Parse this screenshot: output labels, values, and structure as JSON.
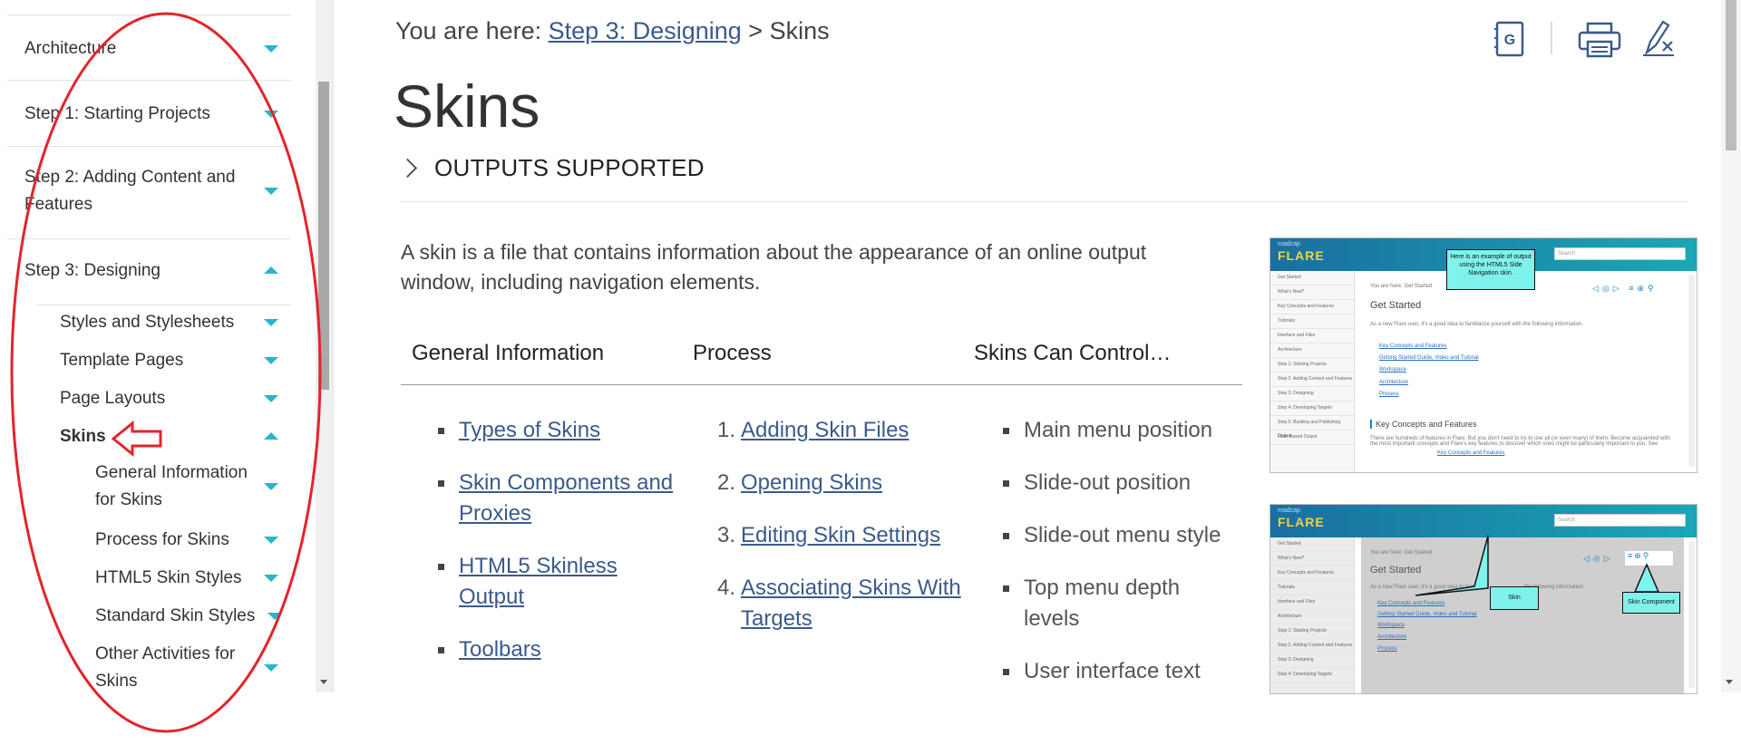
{
  "sidebar": {
    "items": [
      {
        "label": "Architecture",
        "expanded": false
      },
      {
        "label": "Step 1: Starting Projects",
        "expanded": false
      },
      {
        "label": "Step 2: Adding Content and Features",
        "expanded": false
      },
      {
        "label": "Step 3: Designing",
        "expanded": true
      },
      {
        "label": "Styles and Stylesheets",
        "expanded": false
      },
      {
        "label": "Template Pages",
        "expanded": false
      },
      {
        "label": "Page Layouts",
        "expanded": false
      },
      {
        "label": "Skins",
        "expanded": true,
        "selected": true
      },
      {
        "label": "General Information for Skins",
        "expanded": false
      },
      {
        "label": "Process for Skins",
        "expanded": false
      },
      {
        "label": "HTML5 Skin Styles",
        "expanded": false
      },
      {
        "label": "Standard Skin Styles",
        "expanded": false
      },
      {
        "label": "Other Activities for Skins",
        "expanded": false
      }
    ]
  },
  "breadcrumb": {
    "prefix": "You are here: ",
    "link": "Step 3: Designing",
    "separator": " > ",
    "current": "Skins"
  },
  "page": {
    "title": "Skins",
    "outputs_label": "OUTPUTS SUPPORTED",
    "intro": "A skin is a file that contains information about the appearance of an online output window, including navigation elements."
  },
  "toolbar": {
    "glossary_icon": "glossary-icon",
    "print_icon": "print-icon",
    "remove_highlight_icon": "remove-highlight-icon"
  },
  "table": {
    "headers": [
      "General Information",
      "Process",
      "Skins Can Control…"
    ],
    "general": [
      "Types of Skins",
      "Skin Components and Proxies",
      "HTML5 Skinless Output",
      "Toolbars"
    ],
    "process": [
      "Adding Skin Files",
      "Opening Skins",
      "Editing Skin Settings",
      "Associating Skins With Targets"
    ],
    "controls": [
      "Main menu position",
      "Slide-out position",
      "Slide-out menu style",
      "Top menu depth levels",
      "User interface text"
    ]
  },
  "thumb1": {
    "brand_small": "madcap",
    "brand": "FLARE",
    "search": "Search",
    "crumb": "You are here: Get Started",
    "heading": "Get Started",
    "intro": "As a new Flare user, it's a good idea to familiarize yourself with the following information.",
    "links": [
      "Key Concepts and Features",
      "Getting Started Guide, Video and Tutorial",
      "Workspace",
      "Architecture",
      "Process"
    ],
    "section": "Key Concepts and Features",
    "section_text": "There are hundreds of features in Flare. But you don't need to try to use all (or even many) of them. Become acquainted with the most important concepts and Flare's key features to discover which ones might be particularly important to you. See",
    "section_link": "Key Concepts and Features",
    "callout": "Here is an example of output using the HTML5 Side Navigation skin.",
    "side": [
      "Get Started",
      "What's New?",
      "Key Concepts and Features",
      "Tutorials",
      "Interface and Files",
      "Architecture",
      "Step 1: Starting Projects",
      "Step 2: Adding Content and Features",
      "Step 3: Designing",
      "Step 4: Developing Targets",
      "Step 5: Building and Publishing Output",
      "Flare-Based Output"
    ]
  },
  "thumb2": {
    "brand_small": "madcap",
    "brand": "FLARE",
    "search": "Search",
    "crumb": "You are here: Get Started",
    "heading": "Get Started",
    "intro": "As a new Flare user, it's a good idea to fam",
    "intro_tail": "the following information.",
    "links": [
      "Key Concepts and Features",
      "Getting Started Guide, Video and Tutorial",
      "Workspace",
      "Architecture",
      "Process"
    ],
    "callout_skin": "Skin",
    "callout_component": "Skin Component",
    "side": [
      "Get Started",
      "What's New?",
      "Key Concepts and Features",
      "Tutorials",
      "Interface and Files",
      "Architecture",
      "Step 1: Starting Projects",
      "Step 2: Adding Content and Features",
      "Step 3: Designing",
      "Step 4: Developing Targets"
    ]
  },
  "colors": {
    "accent": "#27b7c9",
    "link": "#3b5a8c",
    "annotation": "#e3242b"
  }
}
